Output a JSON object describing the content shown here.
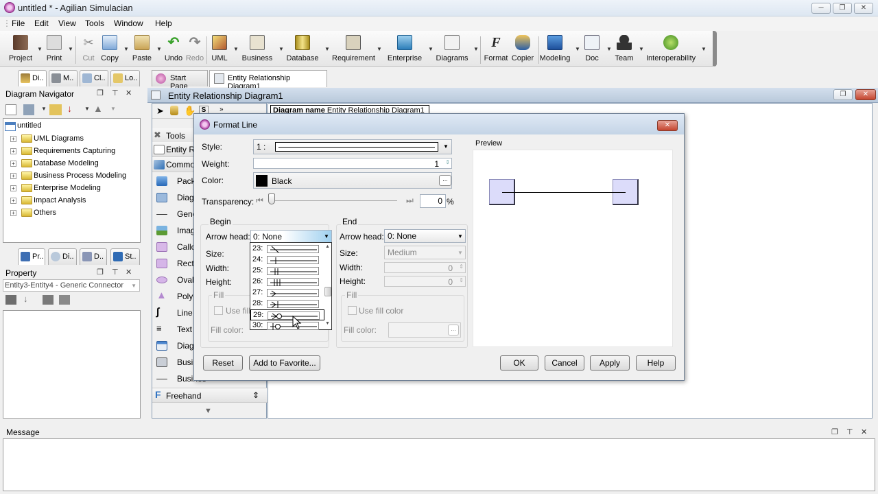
{
  "window": {
    "title": "untitled * - Agilian Simulacian"
  },
  "menu": [
    "File",
    "Edit",
    "View",
    "Tools",
    "Window",
    "Help"
  ],
  "toolbar": {
    "items": [
      {
        "label": "Project",
        "icon": "project-icon",
        "enabled": true
      },
      {
        "label": "Print",
        "icon": "print-icon",
        "enabled": true
      },
      {
        "label": "Cut",
        "icon": "cut-icon",
        "enabled": false
      },
      {
        "label": "Copy",
        "icon": "copy-icon",
        "enabled": true
      },
      {
        "label": "Paste",
        "icon": "paste-icon",
        "enabled": true
      },
      {
        "label": "Undo",
        "icon": "undo-icon",
        "enabled": true
      },
      {
        "label": "Redo",
        "icon": "redo-icon",
        "enabled": false
      },
      {
        "label": "UML",
        "icon": "uml-icon",
        "enabled": true
      },
      {
        "label": "Business",
        "icon": "business-icon",
        "enabled": true
      },
      {
        "label": "Database",
        "icon": "database-icon",
        "enabled": true
      },
      {
        "label": "Requirement",
        "icon": "requirement-icon",
        "enabled": true
      },
      {
        "label": "Enterprise",
        "icon": "enterprise-icon",
        "enabled": true
      },
      {
        "label": "Diagrams",
        "icon": "diagrams-icon",
        "enabled": true
      },
      {
        "label": "Format",
        "icon": "format-icon",
        "enabled": true
      },
      {
        "label": "Copier",
        "icon": "copier-icon",
        "enabled": true
      },
      {
        "label": "Modeling",
        "icon": "modeling-icon",
        "enabled": true
      },
      {
        "label": "Doc",
        "icon": "doc-icon",
        "enabled": true
      },
      {
        "label": "Team",
        "icon": "team-icon",
        "enabled": true
      },
      {
        "label": "Interoperability",
        "icon": "interoperability-icon",
        "enabled": true
      }
    ]
  },
  "left_tabs_top": [
    "Di..",
    "M..",
    "Cl..",
    "Lo.."
  ],
  "diagram_navigator": {
    "title": "Diagram Navigator",
    "root": "untitled",
    "items": [
      "UML Diagrams",
      "Requirements Capturing",
      "Database Modeling",
      "Business Process Modeling",
      "Enterprise Modeling",
      "Impact Analysis",
      "Others"
    ]
  },
  "left_tabs_bottom": [
    "Pr..",
    "Di..",
    "D..",
    "St.."
  ],
  "property": {
    "title": "Property",
    "selected": "Entity3-Entity4 - Generic Connector"
  },
  "doc_tabs": [
    {
      "label": "Start Page",
      "active": false
    },
    {
      "label": "Entity Relationship Diagram1",
      "active": true
    }
  ],
  "document": {
    "title": "Entity Relationship Diagram1",
    "diagram_name_label": "Diagram name",
    "diagram_name_value": "Entity Relationship Diagram1"
  },
  "palette": {
    "sections": [
      "Tools",
      "Entity R",
      "Common"
    ],
    "items": [
      "Packag",
      "Diagra",
      "Generi",
      "Image",
      "Callout",
      "Rectan",
      "Oval",
      "Polygo",
      "Line",
      "Text Bo",
      "Diagra",
      "Busines",
      "Busines"
    ],
    "footer": "Freehand"
  },
  "dialog": {
    "title": "Format Line",
    "style_label": "Style:",
    "style_value": "1 :",
    "weight_label": "Weight:",
    "weight_value": "1",
    "color_label": "Color:",
    "color_value": "Black",
    "color_swatch": "#000000",
    "transparency_label": "Transparency:",
    "transparency_value": "0",
    "transparency_unit": "%",
    "begin": {
      "title": "Begin",
      "arrow_label": "Arrow head:",
      "arrow_value": "0: None",
      "size_label": "Size:",
      "width_label": "Width:",
      "height_label": "Height:",
      "fill_title": "Fill",
      "use_fill_label": "Use fill color",
      "fill_color_label": "Fill color:"
    },
    "end": {
      "title": "End",
      "arrow_label": "Arrow head:",
      "arrow_value": "0: None",
      "size_label": "Size:",
      "size_value": "Medium",
      "width_label": "Width:",
      "width_value": "0",
      "height_label": "Height:",
      "height_value": "0",
      "fill_title": "Fill",
      "use_fill_label": "Use fill color",
      "fill_color_label": "Fill color:"
    },
    "dropdown_items": [
      "23:",
      "24:",
      "25:",
      "26:",
      "27:",
      "28:",
      "29:",
      "30:"
    ],
    "dropdown_highlighted": "29:",
    "preview_label": "Preview",
    "buttons": {
      "reset": "Reset",
      "favorite": "Add to Favorite...",
      "ok": "OK",
      "cancel": "Cancel",
      "apply": "Apply",
      "help": "Help"
    }
  },
  "message": {
    "title": "Message"
  }
}
